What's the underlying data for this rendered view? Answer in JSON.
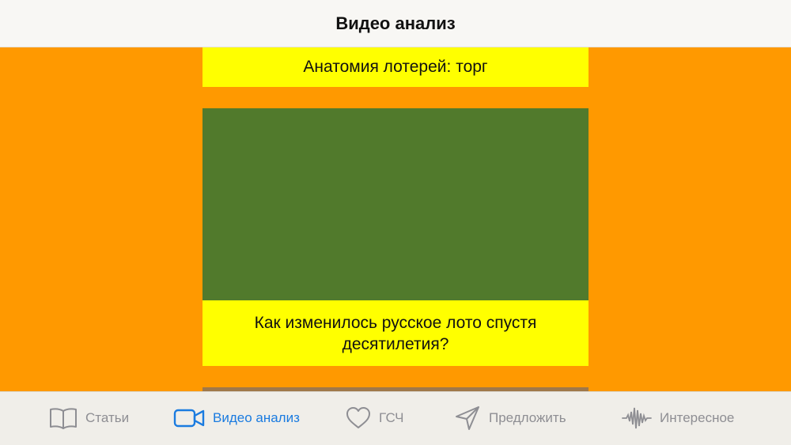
{
  "header": {
    "title": "Видео анализ"
  },
  "feed": {
    "partial_card_title": "Анатомия лотерей: торг",
    "video_card": {
      "thumbnail_color": "#517A2C",
      "caption": "Как изменилось русское лото спустя десятилетия?"
    }
  },
  "colors": {
    "background": "#FF9900",
    "card_caption_bg": "#FFFF00",
    "tab_active": "#1A7BE0",
    "tab_inactive": "#8E8E93"
  },
  "tabbar": {
    "items": [
      {
        "label": "Статьи",
        "icon": "book-icon",
        "active": false
      },
      {
        "label": "Видео анализ",
        "icon": "video-camera-icon",
        "active": true
      },
      {
        "label": "ГСЧ",
        "icon": "heart-icon",
        "active": false
      },
      {
        "label": "Предложить",
        "icon": "send-icon",
        "active": false
      },
      {
        "label": "Интересное",
        "icon": "waveform-icon",
        "active": false
      }
    ]
  }
}
